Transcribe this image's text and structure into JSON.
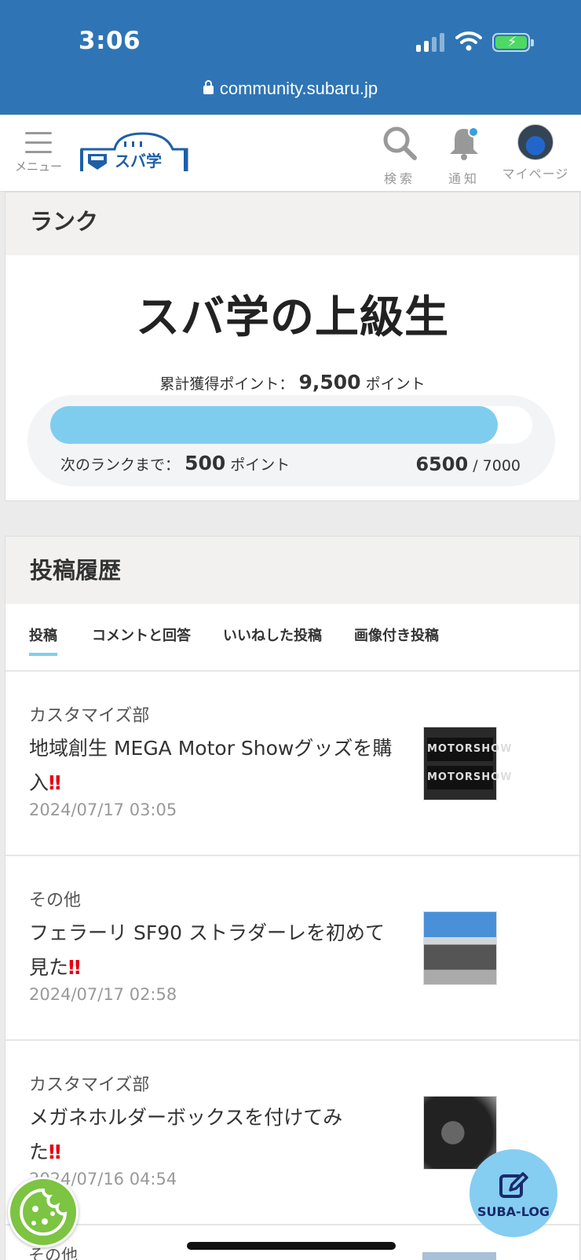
{
  "status_bar": {
    "time": "3:06",
    "url": "community.subaru.jp"
  },
  "header": {
    "menu_label": "メニュー",
    "logo_text": "スバ学",
    "search_label": "検索",
    "notify_label": "通知",
    "mypage_label": "マイページ"
  },
  "rank": {
    "heading": "ランク",
    "title": "スバ学の上級生",
    "total_label": "累計獲得ポイント：",
    "total_value": "9,500",
    "points_unit": "ポイント",
    "next_label": "次のランクまで：",
    "next_value": "500",
    "current": "6500",
    "max": "/ 7000",
    "progress_fraction": 0.929
  },
  "history": {
    "heading": "投稿履歴",
    "tabs": [
      {
        "label": "投稿",
        "active": true
      },
      {
        "label": "コメントと回答",
        "active": false
      },
      {
        "label": "いいねした投稿",
        "active": false
      },
      {
        "label": "画像付き投稿",
        "active": false
      }
    ],
    "posts": [
      {
        "category": "カスタマイズ部",
        "title_line1": "地域創生 MEGA Motor Showグッズを購",
        "title_line2": "入",
        "emphasis": "‼",
        "date": "2024/07/17 03:05",
        "thumb_text": "MOTORSHOW"
      },
      {
        "category": "その他",
        "title_line1": "フェラーリ SF90 ストラダーレを初めて",
        "title_line2": "見た",
        "emphasis": "‼",
        "date": "2024/07/17 02:58"
      },
      {
        "category": "カスタマイズ部",
        "title_line1": "メガネホルダーボックスを付けてみ",
        "title_line2": "た",
        "emphasis": "‼",
        "date": "2024/07/16 04:54"
      }
    ],
    "next_category_peek": "その他"
  },
  "fab": {
    "label": "SUBA-LOG"
  },
  "colors": {
    "brand_blue": "#2f75b5",
    "progress": "#7fcdee",
    "fab": "#86cdf2",
    "emphasis": "#e60012"
  }
}
